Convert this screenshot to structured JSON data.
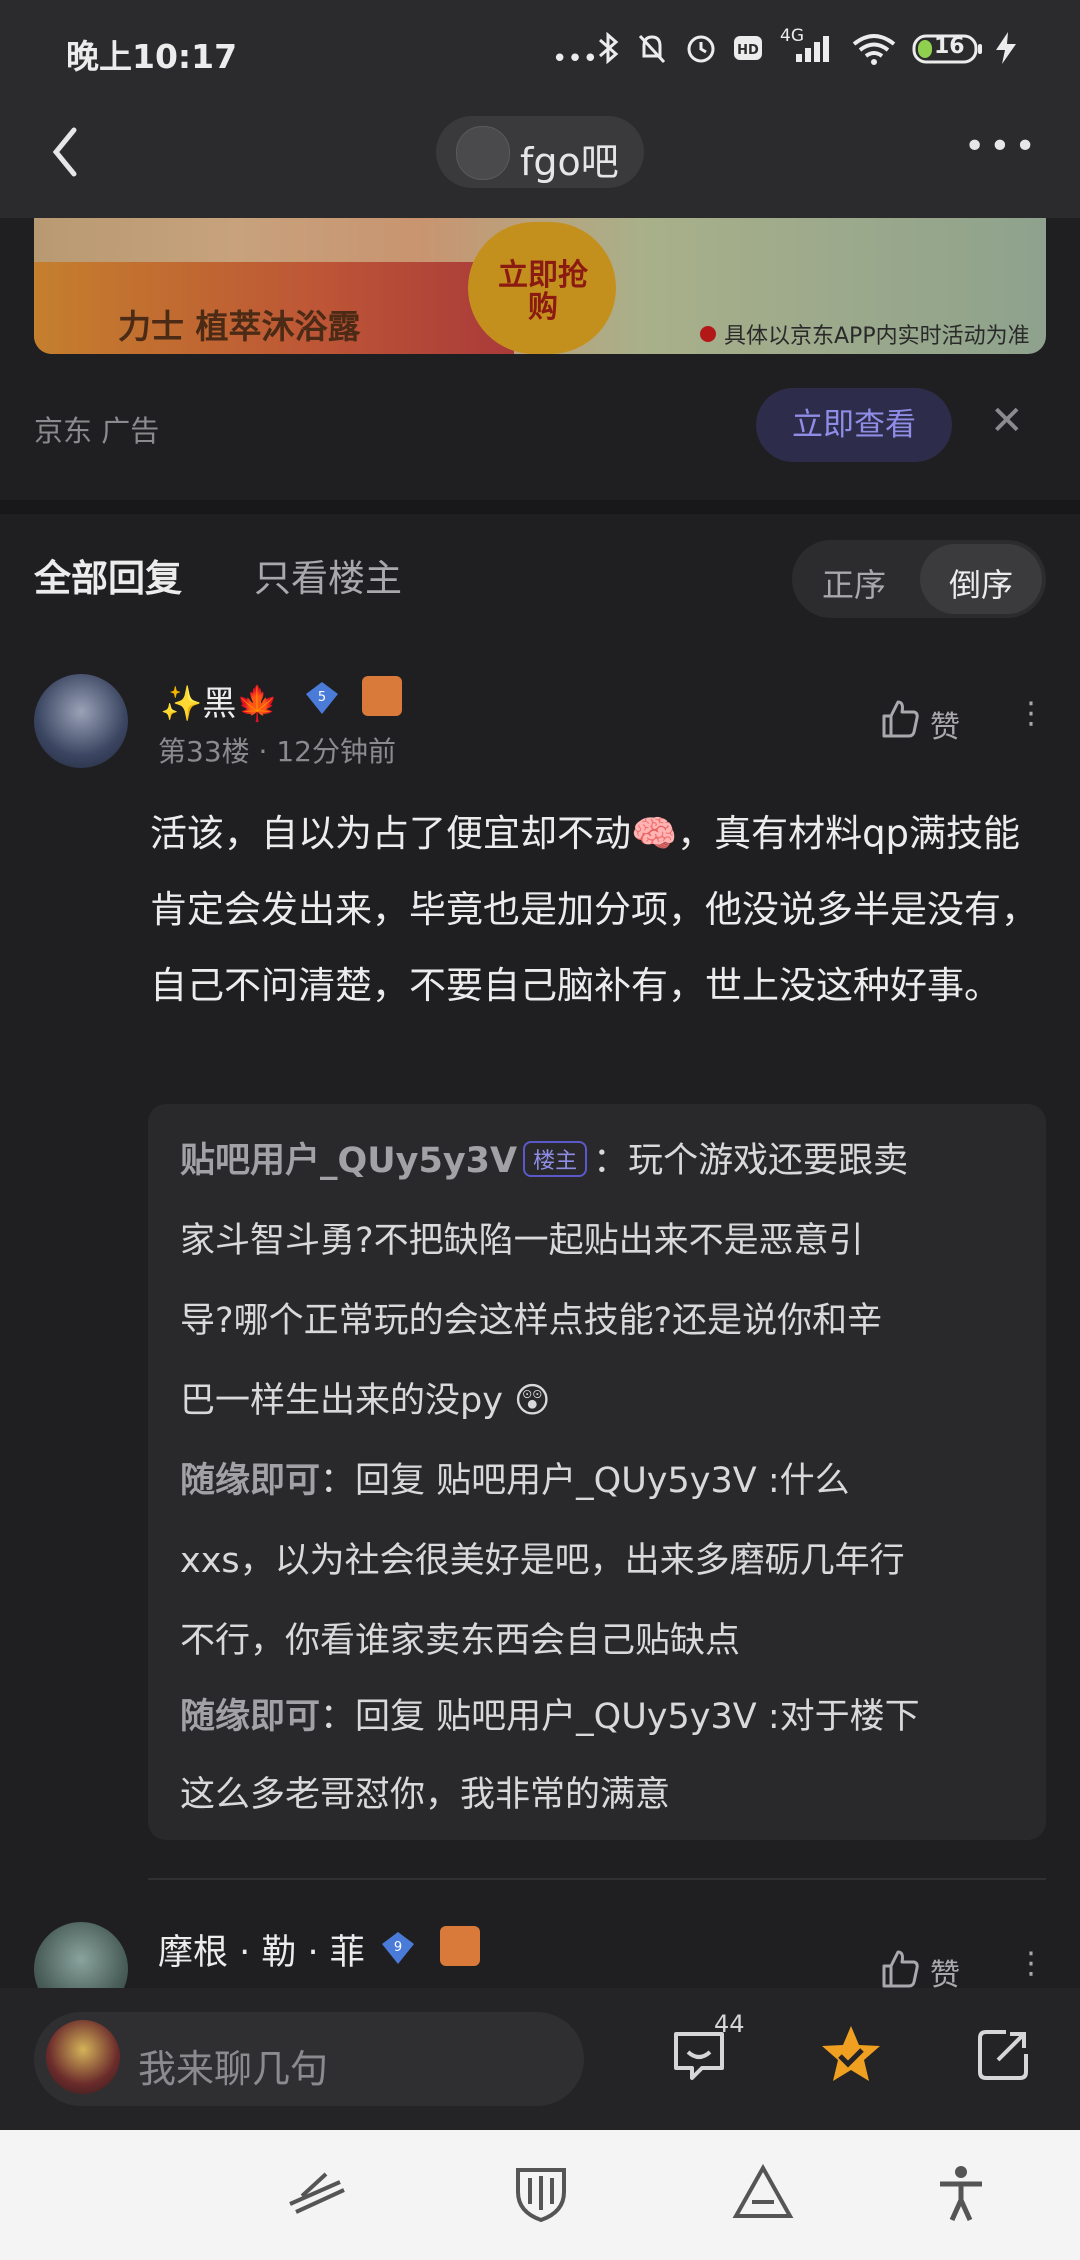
{
  "status_bar": {
    "time": "晚上10:17",
    "network": "4G",
    "battery": "16"
  },
  "nav": {
    "forum_name": "fgo吧",
    "more_label": "•••"
  },
  "ad": {
    "product_text": "力士  植萃沐浴露",
    "buy_text": "立即抢购",
    "disclaimer": "具体以京东APP内实时活动为准",
    "source": "京东  广告",
    "view_button": "立即查看",
    "close_label": "✕"
  },
  "tabs": {
    "all": "全部回复",
    "op_only": "只看楼主",
    "sort_asc": "正序",
    "sort_desc": "倒序"
  },
  "posts": [
    {
      "username": "✨黑🍁",
      "level": "5",
      "meta": "第33楼  ·  12分钟前",
      "like_label": "赞",
      "content": "活该，自以为占了便宜却不动🧠，真有材料qp满技能肯定会发出来，毕竟也是加分项，他没说多半是没有，自己不问清楚，不要自己脑补有，世上没这种好事。",
      "quotes": [
        {
          "name": "贴吧用户_QUy5y3V",
          "tag": "楼主",
          "lines": [
            "：玩个游戏还要跟卖",
            "家斗智斗勇?不把缺陷一起贴出来不是恶意引",
            "导?哪个正常玩的会这样点技能?还是说你和辛",
            "巴一样生出来的没py 😲"
          ]
        },
        {
          "name": "随缘即可",
          "lines": [
            "：回复 贴吧用户_QUy5y3V :什么",
            "xxs，以为社会很美好是吧，出来多磨砺几年行",
            "不行，你看谁家卖东西会自己贴缺点"
          ]
        },
        {
          "name": "随缘即可",
          "lines": [
            "：回复 贴吧用户_QUy5y3V :对于楼下",
            "这么多老哥怼你，我非常的满意"
          ]
        }
      ]
    },
    {
      "username": "摩根 · 勒 · 菲",
      "level": "9",
      "like_label": "赞"
    }
  ],
  "reply_bar": {
    "placeholder": "我来聊几句",
    "comment_count": "44"
  },
  "colors": {
    "background": "#1f1f21",
    "accent": "#8f8de6",
    "favorite": "#f0a020"
  }
}
